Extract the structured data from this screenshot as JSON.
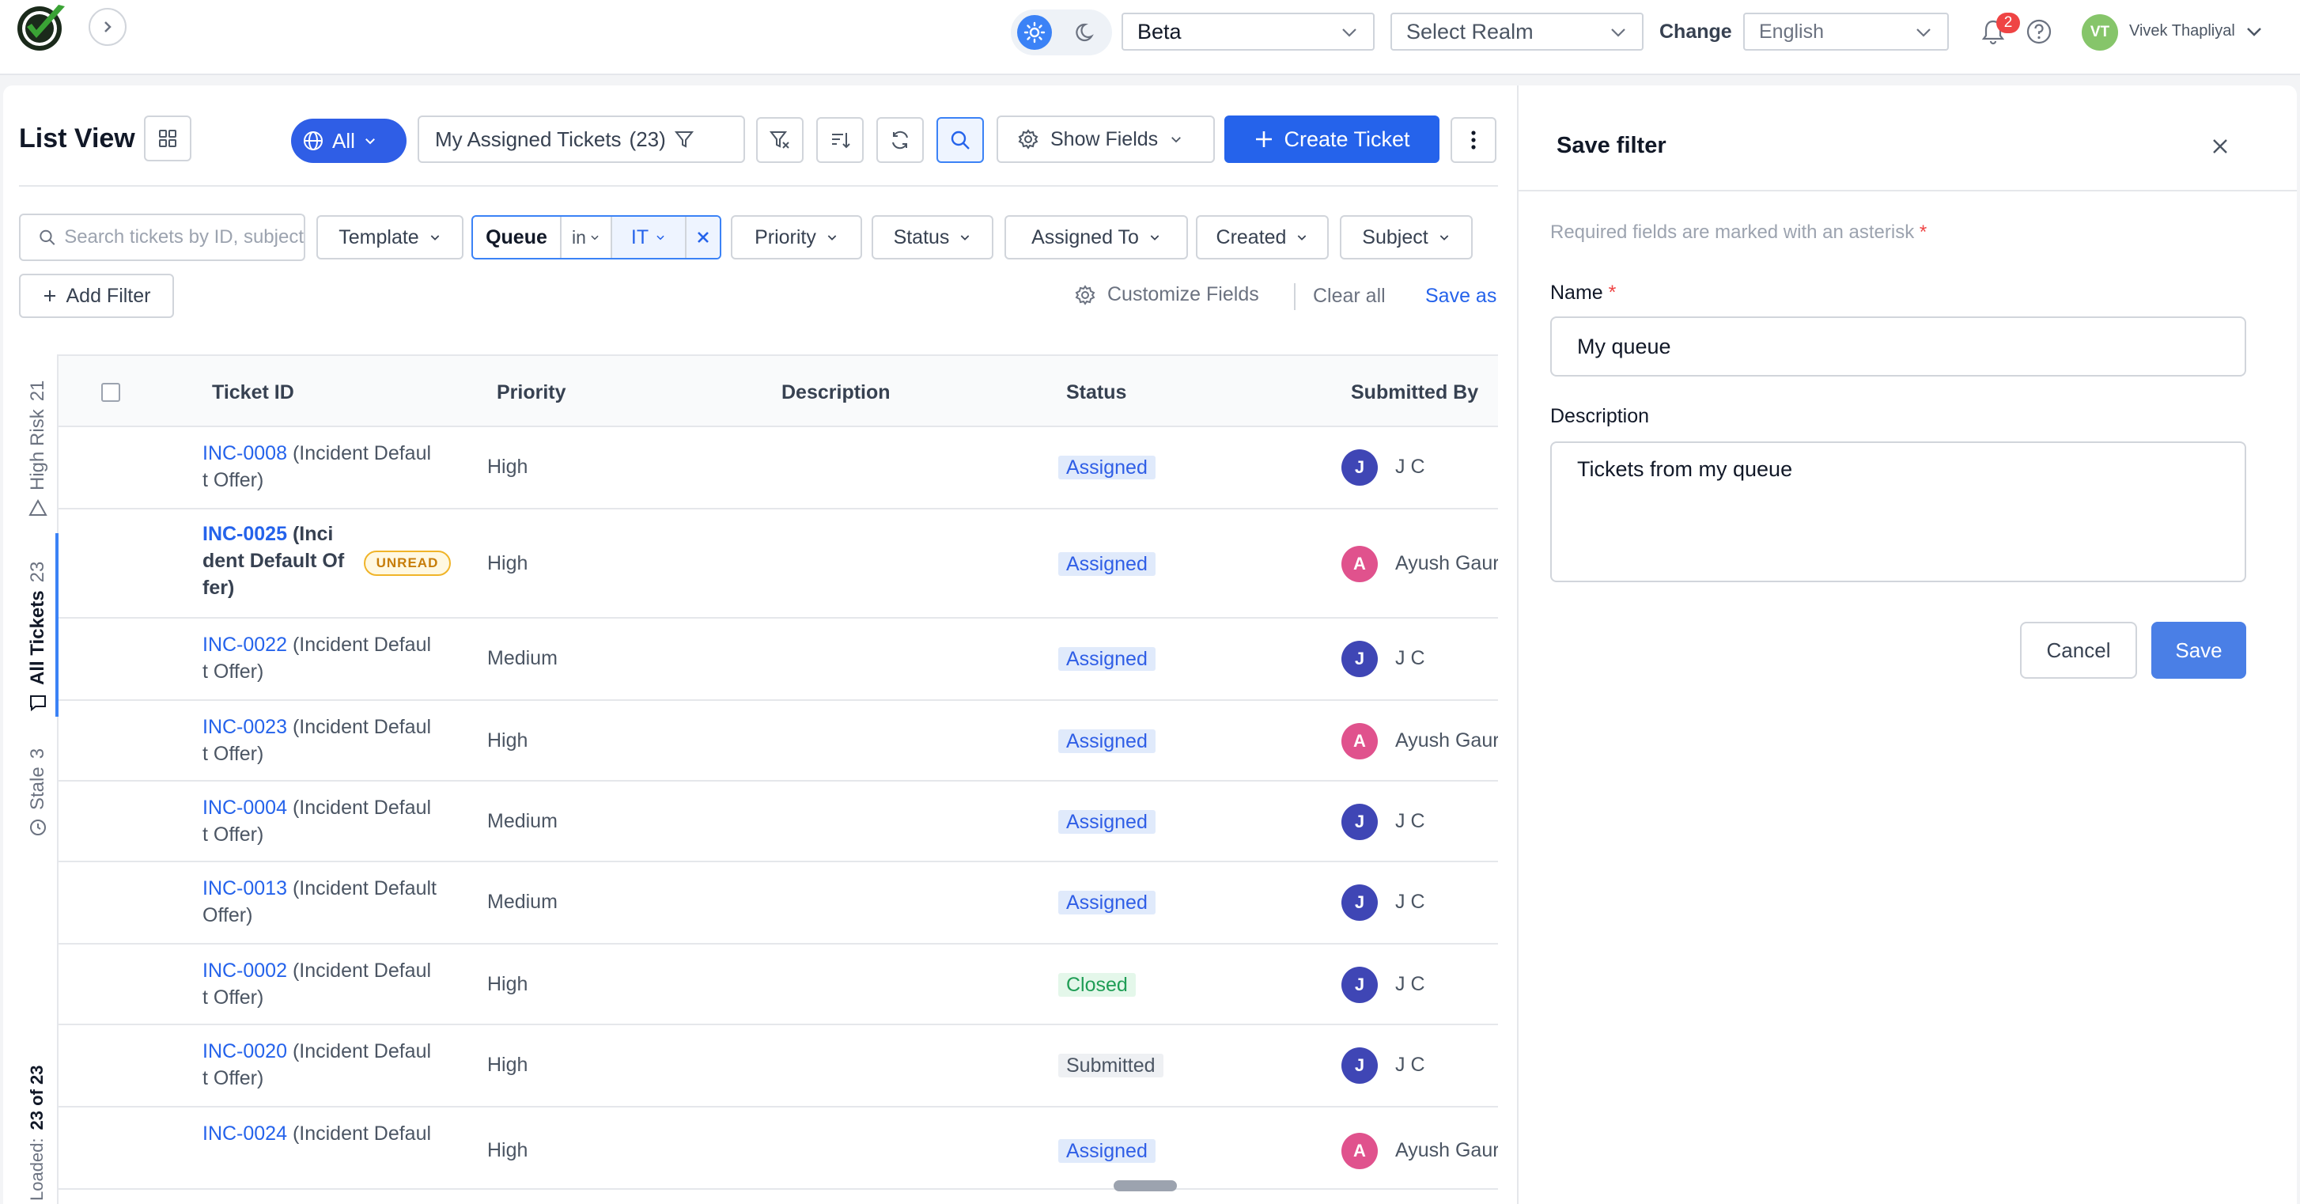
{
  "topbar": {
    "env_select": "Beta",
    "realm_select": "Select Realm",
    "change_label": "Change",
    "language_select": "English",
    "notification_count": "2",
    "user_initials": "VT",
    "user_name": "Vivek Thapliyal"
  },
  "toolbar": {
    "title": "List View",
    "scope_label": "All",
    "view_label": "My Assigned Tickets",
    "view_count": "(23)",
    "show_fields_label": "Show Fields",
    "create_label": "Create Ticket"
  },
  "filters": {
    "search_placeholder": "Search tickets by ID, subject",
    "template": "Template",
    "queue_label": "Queue",
    "queue_operator": "in",
    "queue_value": "IT",
    "priority": "Priority",
    "status": "Status",
    "assigned_to": "Assigned To",
    "created": "Created",
    "subject": "Subject",
    "add_filter": "Add Filter",
    "customize_fields": "Customize Fields",
    "clear_all": "Clear all",
    "save_as": "Save as"
  },
  "side_tabs": {
    "high_risk": "High Risk",
    "high_risk_count": "21",
    "all_tickets": "All Tickets",
    "all_tickets_count": "23",
    "stale": "Stale",
    "stale_count": "3",
    "loaded_prefix": "Loaded:",
    "loaded_value": "23 of 23"
  },
  "table": {
    "columns": {
      "ticket_id": "Ticket ID",
      "priority": "Priority",
      "description": "Description",
      "status": "Status",
      "submitted_by": "Submitted By"
    },
    "rows": [
      {
        "id": "INC-0008",
        "rest_l1": " (Incident Defaul",
        "rest_l2": "t Offer)",
        "priority": "High",
        "status": "Assigned",
        "initial": "J",
        "submitter": "J C"
      },
      {
        "id": "INC-0025",
        "rest_l1": " (Inci",
        "rest_l2": "dent Default Of",
        "rest_l3": "fer)",
        "badge": "UNREAD",
        "priority": "High",
        "status": "Assigned",
        "initial": "A",
        "submitter": "Ayush Gaur"
      },
      {
        "id": "INC-0022",
        "rest_l1": " (Incident Defaul",
        "rest_l2": "t Offer)",
        "priority": "Medium",
        "status": "Assigned",
        "initial": "J",
        "submitter": "J C"
      },
      {
        "id": "INC-0023",
        "rest_l1": " (Incident Defaul",
        "rest_l2": "t Offer)",
        "priority": "High",
        "status": "Assigned",
        "initial": "A",
        "submitter": "Ayush Gaur"
      },
      {
        "id": "INC-0004",
        "rest_l1": " (Incident Defaul",
        "rest_l2": "t Offer)",
        "priority": "Medium",
        "status": "Assigned",
        "initial": "J",
        "submitter": "J C"
      },
      {
        "id": "INC-0013",
        "rest_l1": " (Incident Default",
        "rest_l2": "Offer)",
        "priority": "Medium",
        "status": "Assigned",
        "initial": "J",
        "submitter": "J C"
      },
      {
        "id": "INC-0002",
        "rest_l1": " (Incident Defaul",
        "rest_l2": "t Offer)",
        "priority": "High",
        "status": "Closed",
        "initial": "J",
        "submitter": "J C"
      },
      {
        "id": "INC-0020",
        "rest_l1": " (Incident Defaul",
        "rest_l2": "t Offer)",
        "priority": "High",
        "status": "Submitted",
        "initial": "J",
        "submitter": "J C"
      },
      {
        "id": "INC-0024",
        "rest_l1": " (Incident Defaul",
        "rest_l2": "",
        "priority": "High",
        "status": "Assigned",
        "initial": "A",
        "submitter": "Ayush Gaur"
      }
    ]
  },
  "save_filter": {
    "title": "Save filter",
    "required_note": "Required fields are marked with an asterisk",
    "asterisk": "*",
    "name_label": "Name",
    "name_value": "My queue",
    "description_label": "Description",
    "description_value": "Tickets from my queue",
    "cancel_label": "Cancel",
    "save_label": "Save"
  },
  "colors": {
    "primary": "#2563eb",
    "avatar_j": "#3f46b5",
    "avatar_a": "#e0528d",
    "avatar_vt": "#86c56a"
  }
}
